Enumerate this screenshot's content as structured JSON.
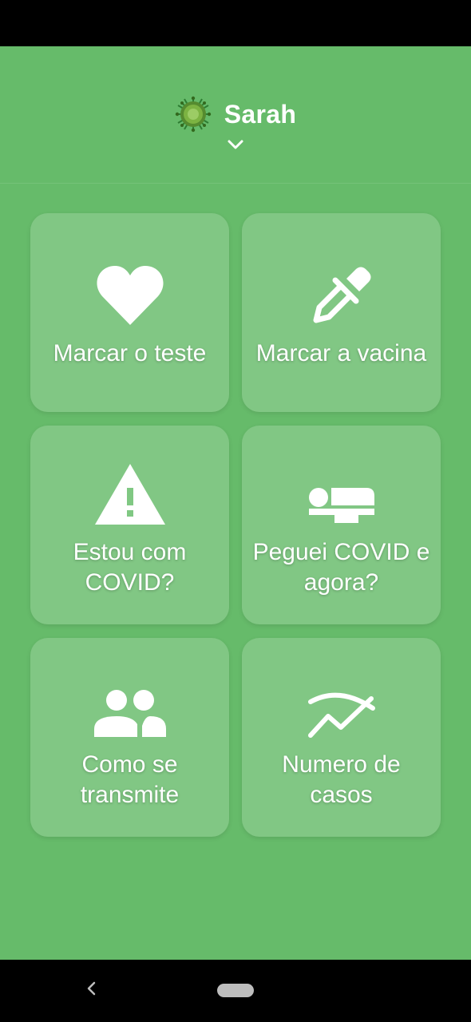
{
  "user": {
    "name": "Sarah"
  },
  "tiles": [
    {
      "label": "Marcar o teste",
      "icon": "heart-icon"
    },
    {
      "label": "Marcar a vacina",
      "icon": "syringe-icon"
    },
    {
      "label": "Estou com\nCOVID?",
      "icon": "warning-icon"
    },
    {
      "label": "Peguei COVID e\nagora?",
      "icon": "bed-icon"
    },
    {
      "label": "Como se\ntransmite",
      "icon": "people-icon"
    },
    {
      "label": "Numero de\ncasos",
      "icon": "trending-icon"
    }
  ],
  "colors": {
    "background": "#66bb6a",
    "tile": "rgba(255,255,255,0.18)",
    "text": "#ffffff"
  }
}
